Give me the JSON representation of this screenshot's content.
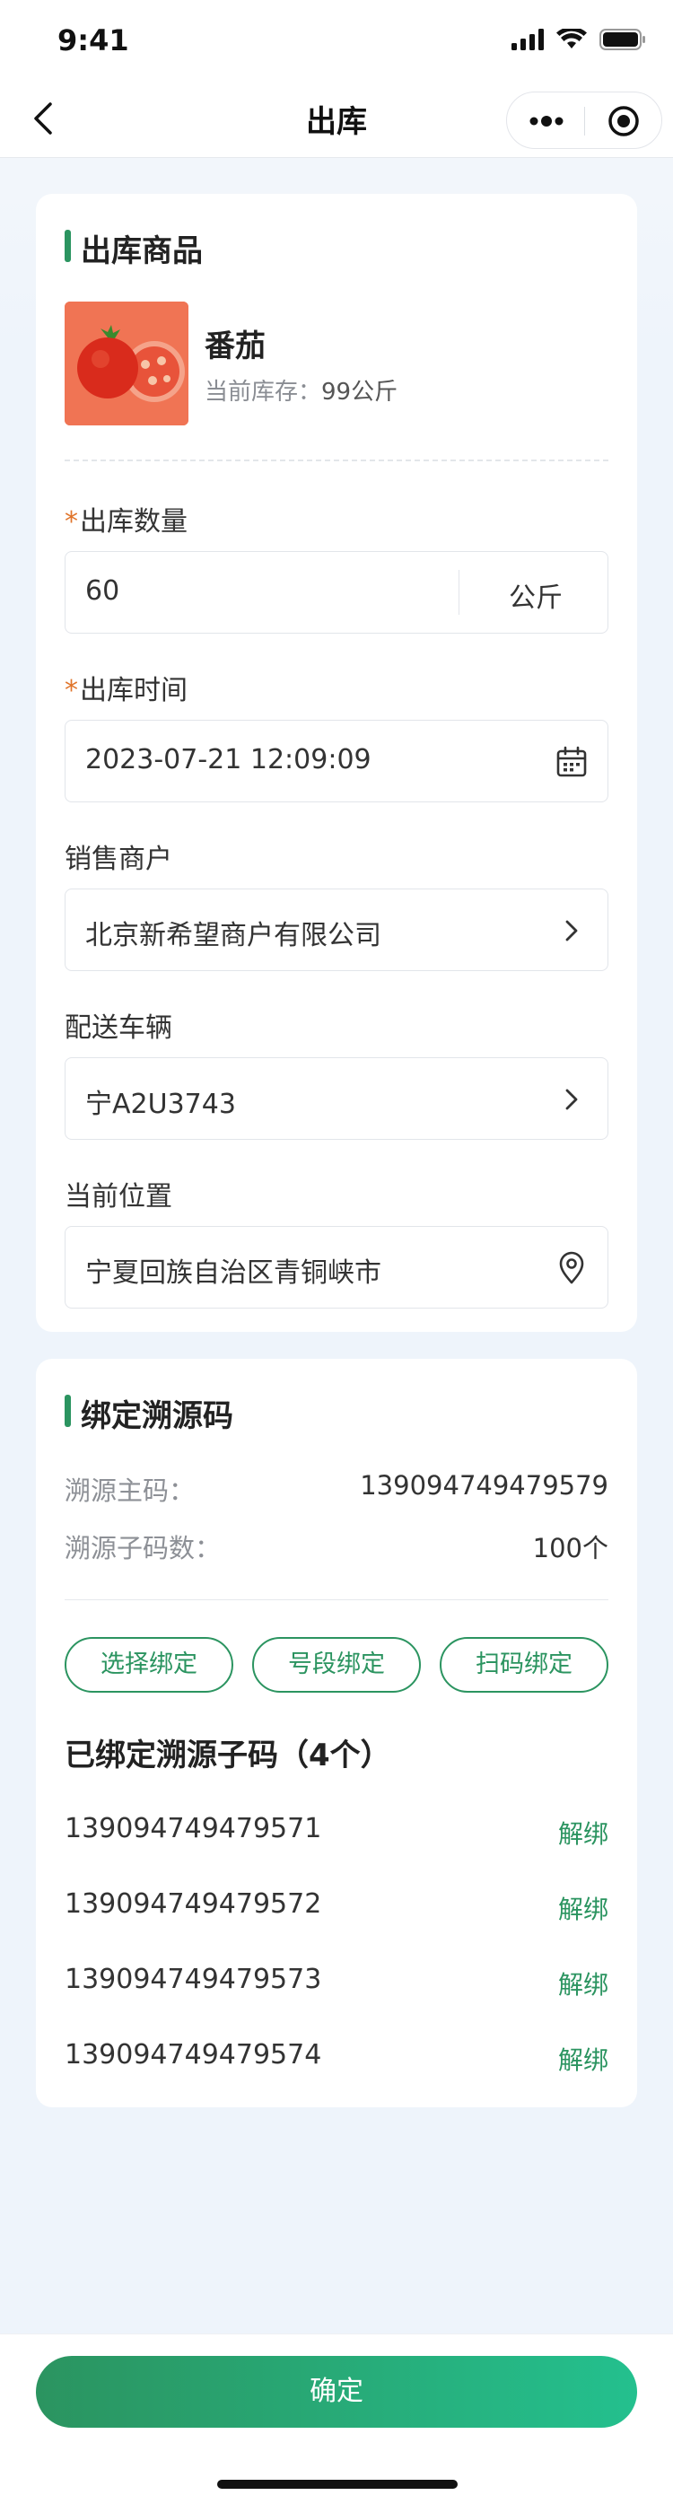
{
  "status_bar": {
    "time": "9:41"
  },
  "nav": {
    "title": "出库"
  },
  "product_section": {
    "title": "出库商品",
    "product_name": "番茄",
    "stock_label": "当前库存：",
    "stock_value": "99公斤"
  },
  "form": {
    "quantity": {
      "label": "出库数量",
      "required_mark": "*",
      "value": "60",
      "unit": "公斤"
    },
    "time": {
      "label": "出库时间",
      "required_mark": "*",
      "value": "2023-07-21 12:09:09"
    },
    "merchant": {
      "label": "销售商户",
      "value": "北京新希望商户有限公司"
    },
    "vehicle": {
      "label": "配送车辆",
      "value": "宁A2U3743"
    },
    "location": {
      "label": "当前位置",
      "value": "宁夏回族自治区青铜峡市"
    }
  },
  "trace_section": {
    "title": "绑定溯源码",
    "main_code_label": "溯源主码：",
    "main_code_value": "139094749479579",
    "sub_count_label": "溯源子码数：",
    "sub_count_value": "100个",
    "buttons": [
      "选择绑定",
      "号段绑定",
      "扫码绑定"
    ],
    "bound_title": "已绑定溯源子码（4个）",
    "unbind_label": "解绑",
    "codes": [
      "139094749479571",
      "139094749479572",
      "139094749479573",
      "139094749479574"
    ]
  },
  "bottom": {
    "confirm_label": "确定"
  },
  "colors": {
    "accent": "#2b9460",
    "required": "#e0742a",
    "button_gradient_end": "#24c08e"
  }
}
